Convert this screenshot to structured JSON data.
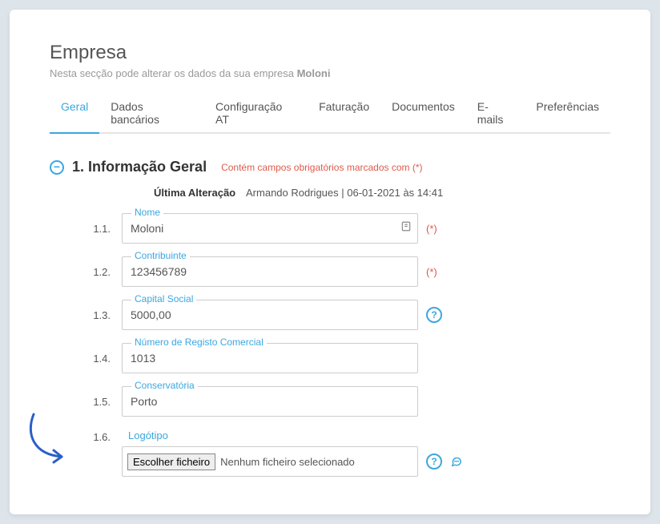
{
  "header": {
    "title": "Empresa",
    "subtitle_prefix": "Nesta secção pode alterar os dados da sua empresa ",
    "subtitle_bold": "Moloni"
  },
  "tabs": [
    {
      "label": "Geral",
      "active": true
    },
    {
      "label": "Dados bancários",
      "active": false
    },
    {
      "label": "Configuração AT",
      "active": false
    },
    {
      "label": "Faturação",
      "active": false
    },
    {
      "label": "Documentos",
      "active": false
    },
    {
      "label": "E-mails",
      "active": false
    },
    {
      "label": "Preferências",
      "active": false
    }
  ],
  "section": {
    "collapse_symbol": "−",
    "title": "1. Informação Geral",
    "note": "Contém campos obrigatórios marcados com (*)",
    "last_mod_label": "Última Alteração",
    "last_mod_value": "Armando Rodrigues | 06-01-2021 às 14:41"
  },
  "required_mark": "(*)",
  "help_mark": "?",
  "fields": {
    "row1": {
      "num": "1.1.",
      "label": "Nome",
      "value": "Moloni"
    },
    "row2": {
      "num": "1.2.",
      "label": "Contribuinte",
      "value": "123456789"
    },
    "row3": {
      "num": "1.3.",
      "label": "Capital Social",
      "value": "5000,00"
    },
    "row4": {
      "num": "1.4.",
      "label": "Número de Registo Comercial",
      "value": "1013"
    },
    "row5": {
      "num": "1.5.",
      "label": "Conservatória",
      "value": "Porto"
    },
    "row6": {
      "num": "1.6.",
      "label": "Logótipo",
      "button": "Escolher ficheiro",
      "status": "Nenhum ficheiro selecionado"
    }
  }
}
